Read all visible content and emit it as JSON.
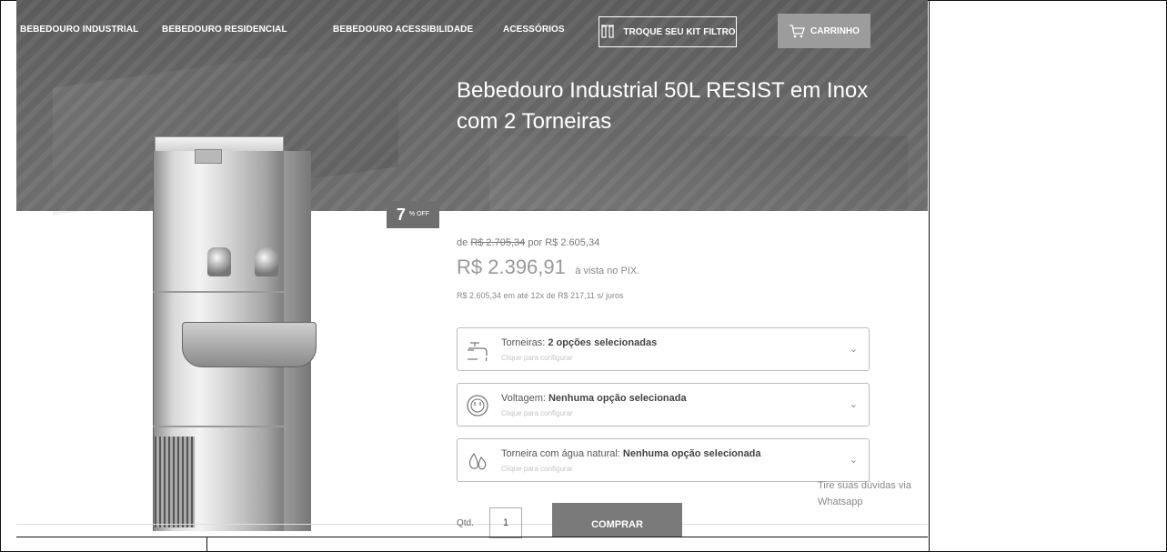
{
  "nav": {
    "items": [
      {
        "label": "BEBEDOURO INDUSTRIAL"
      },
      {
        "label": "BEBEDOURO RESIDENCIAL"
      },
      {
        "label": "BEBEDOURO ACESSIBILIDADE"
      },
      {
        "label": "ACESSÓRIOS"
      }
    ],
    "kit_label": "TROQUE SEU KIT FILTRO",
    "cart_label": "CARRINHO"
  },
  "product": {
    "title": "Bebedouro Industrial 50L RESIST em Inox com 2 Torneiras",
    "discount_number": "7",
    "discount_suffix": "% OFF"
  },
  "pricing": {
    "de_label": "de",
    "old_price": "R$ 2.705,34",
    "por_label": "por R$ 2.605,34",
    "main_price": "R$ 2.396,91",
    "main_suffix": "à vista no PIX.",
    "installments": "R$ 2.605,34 em até 12x de R$ 217,11 s/ juros"
  },
  "options": [
    {
      "prefix": "Torneiras:",
      "value": "2 opções selecionadas",
      "hint": "Clique para configurar",
      "icon": "faucet-icon"
    },
    {
      "prefix": "Voltagem:",
      "value": "Nenhuma opção selecionada",
      "hint": "Clique para configurar",
      "icon": "plug-icon"
    },
    {
      "prefix": "Torneira com água natural:",
      "value": "Nenhuma opção selecionada",
      "hint": "Clique para configurar",
      "icon": "water-drop-icon"
    }
  ],
  "whatsapp": {
    "text": "Tire suas dúvidas via Whatsapp"
  },
  "purchase": {
    "qty_label": "Qtd.",
    "qty_value": "1",
    "buy_label": "COMPRAR"
  },
  "colors": {
    "hero_bg": "#666666",
    "cart_bg": "#9c9c9c",
    "buy_bg": "#7a7a7a"
  }
}
